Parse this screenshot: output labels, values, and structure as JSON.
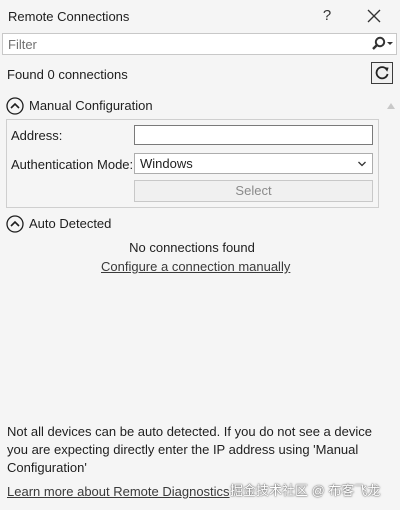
{
  "window": {
    "title": "Remote Connections",
    "help_label": "?"
  },
  "filter": {
    "placeholder": "Filter",
    "value": ""
  },
  "status": {
    "found_text": "Found 0 connections"
  },
  "manual_configuration": {
    "header": "Manual Configuration",
    "address_label": "Address:",
    "address_value": "",
    "auth_label": "Authentication Mode:",
    "auth_selected": "Windows",
    "select_button": "Select"
  },
  "auto_detected": {
    "header": "Auto Detected",
    "empty_text": "No connections found",
    "configure_link": "Configure a connection manually"
  },
  "footer": {
    "note": "Not all devices can be auto detected. If you do not see a device you are expecting directly enter the IP address using 'Manual Configuration'",
    "learn_more_link": "Learn more about Remote Diagnostics"
  },
  "watermark": "掘金技术社区 @ 布客飞龙",
  "icons": {
    "search": "search-icon",
    "refresh": "refresh-icon",
    "close": "close-icon",
    "collapse": "chevron-up-circle-icon",
    "dropdown": "chevron-down-icon"
  }
}
